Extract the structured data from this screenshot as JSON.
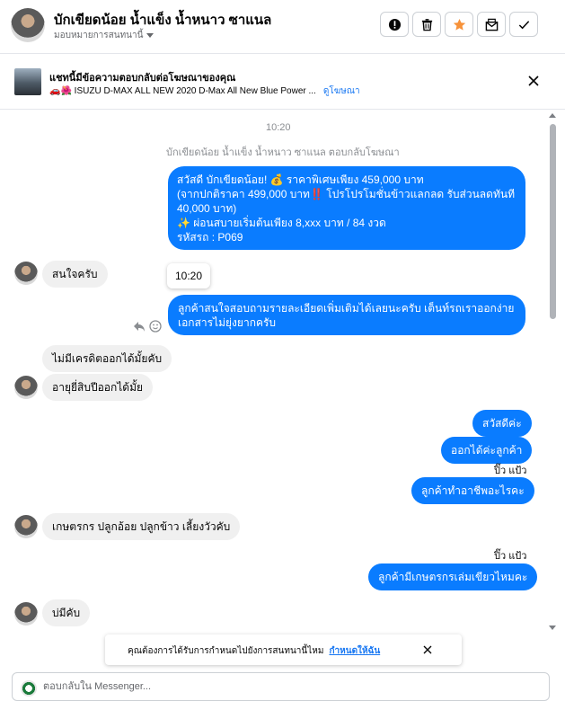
{
  "header": {
    "name": "บักเขียดน้อย น้ำแข็ง น้ำหนาว ซาแนล",
    "assign_label": "มอบหมายการสนทนานี้",
    "buttons": [
      {
        "icon": "exclamation-icon",
        "label": "Mark as spam"
      },
      {
        "icon": "trash-icon",
        "label": "Delete"
      },
      {
        "icon": "star-icon",
        "label": "Star",
        "color": "#f7923a"
      },
      {
        "icon": "mark-unread-icon",
        "label": "Mark as unread"
      },
      {
        "icon": "check-icon",
        "label": "Done"
      }
    ]
  },
  "ad_banner": {
    "title": "แชทนี้มีข้อความตอบกลับต่อโฆษณาของคุณ",
    "subtitle": "🚗🌺 ISUZU D-MAX ALL NEW 2020 D-Max All New Blue Power ...",
    "link": "ดูโฆษณา"
  },
  "conversation": {
    "timestamp": "10:20",
    "reply_note": "บักเขียดน้อย น้ำแข็ง น้ำหนาว ซาแนล ตอบกลับโฆษณา",
    "promo_lines": [
      "สวัสดี บักเขียดน้อย! 💰 ราคาพิเศษเพียง 459,000 บาท",
      "(จากปกติราคา 499,000 บาท‼️ โปรโปรโมชั่นข้าวแลกลด รับส่วนลดทันที",
      "40,000 บาท)",
      "✨ ผ่อนสบายเริ่มต้นเพียง 8,xxx บาท / 84 งวด",
      "รหัสรถ : P069"
    ],
    "msg_interested": "สนใจครับ",
    "tooltip_time": "10:20",
    "msg_details": "ลูกค้าสนใจสอบถามรายละเอียดเพิ่มเติมได้เลยนะครับ เต็นท์รถเราออกง่าย เอกสารไม่ยุ่งยากครับ",
    "msg_no_credit": "ไม่มีเครดิตออกได้มั้ยคับ",
    "msg_age": "อายุยี่สิบปีออกได้มั้ย",
    "msg_hello": "สวัสดีค่ะ",
    "msg_can": "ออกได้ค่ะลูกค้า",
    "seen_1": "ปิ๊ว แป้ว",
    "msg_job": "ลูกค้าทำอาชีพอะไรคะ",
    "msg_farmer": "เกษตรกร ปลูกอ้อย ปลูกข้าว เลี้ยงวัวคับ",
    "seen_2": "ปิ๊ว แป้ว",
    "msg_green_book": "ลูกค้ามีเกษตรกรเล่มเขียวไหมคะ",
    "msg_no": "บ่มีคับ"
  },
  "toast": {
    "text": "คุณต้องการได้รับการกำหนดไปยังการสนทนานี้ไหม",
    "link": "กำหนดให้ฉัน"
  },
  "composer": {
    "placeholder": "ตอบกลับใน Messenger..."
  },
  "colors": {
    "outgoing_bubble": "#0a7cff",
    "incoming_bubble": "#f0f0f0",
    "link": "#1877f2"
  }
}
